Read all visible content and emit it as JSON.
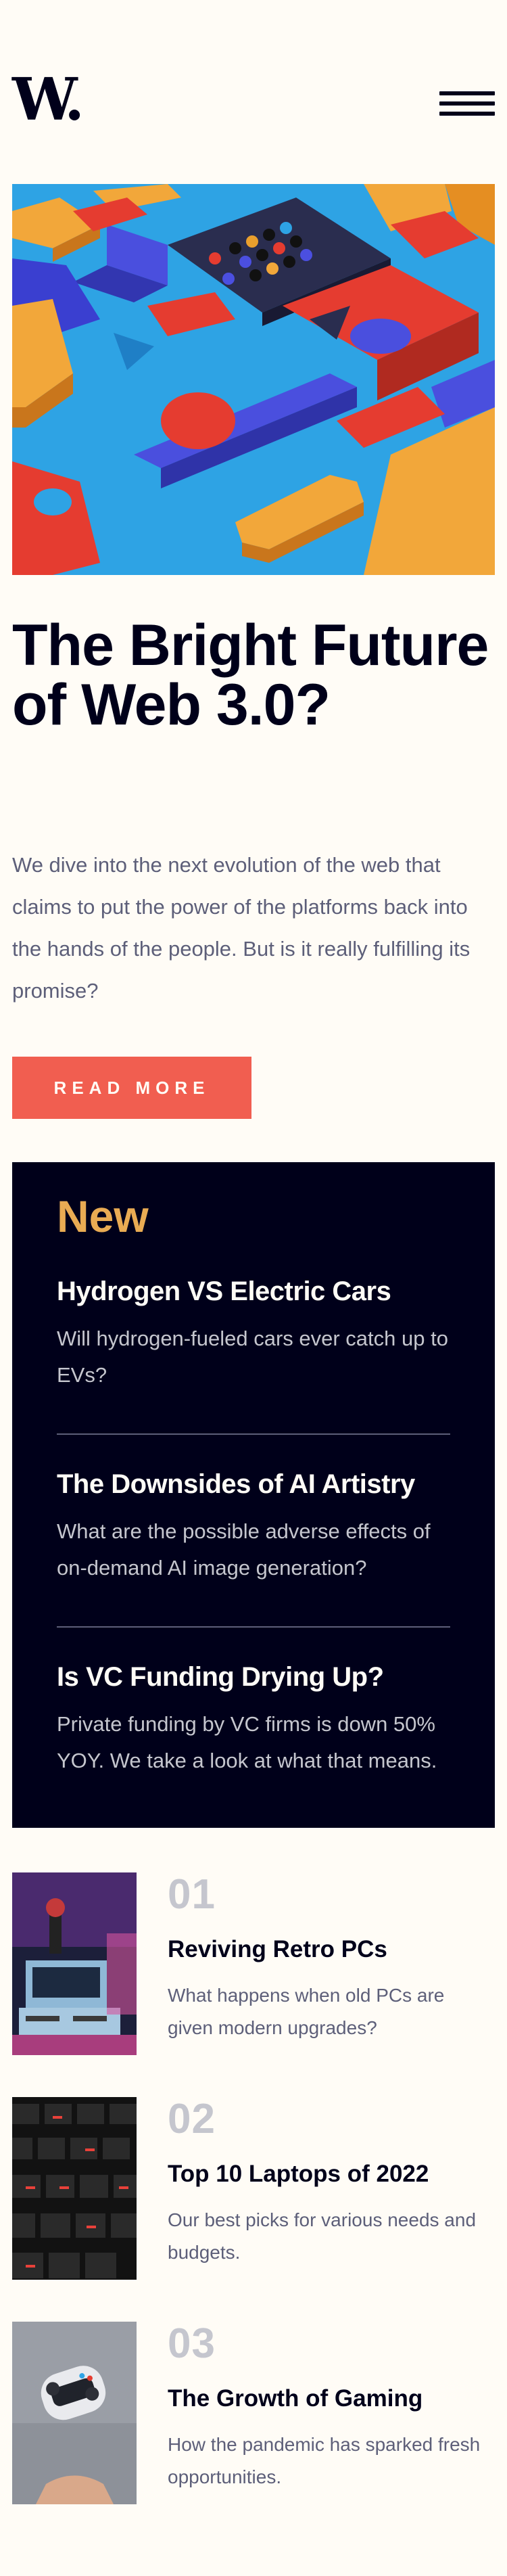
{
  "header": {
    "logo_text": "W.",
    "menu_icon": "hamburger-menu-icon"
  },
  "hero": {
    "image_icon": "abstract-3d-blocks-image",
    "headline": "The Bright Future of Web 3.0?",
    "intro": "We dive into the next evolution of the web that claims to put the power of the platforms back into the hands of the people. But is it really fulfilling its promise?",
    "cta_label": "READ MORE"
  },
  "new_panel": {
    "title": "New",
    "items": [
      {
        "title": "Hydrogen VS Electric Cars",
        "description": "Will hydrogen-fueled cars ever catch up to EVs?"
      },
      {
        "title": "The Downsides of AI Artistry",
        "description": "What are the possible adverse effects of on-demand AI image generation?"
      },
      {
        "title": "Is VC Funding Drying Up?",
        "description": "Private funding by VC firms is down 50% YOY. We take a look at what that means."
      }
    ]
  },
  "articles": [
    {
      "number": "01",
      "title": "Reviving Retro PCs",
      "description": "What happens when old PCs are given modern upgrades?",
      "image_icon": "retro-pc-image"
    },
    {
      "number": "02",
      "title": "Top 10 Laptops of 2022",
      "description": "Our best picks for various needs and budgets.",
      "image_icon": "laptop-keyboard-image"
    },
    {
      "number": "03",
      "title": "The Growth of Gaming",
      "description": "How the pandemic has sparked fresh opportunities.",
      "image_icon": "game-controller-image"
    }
  ],
  "colors": {
    "background": "#fffcf6",
    "dark": "#00001a",
    "accent_red": "#f15e50",
    "accent_orange": "#e9ab53",
    "muted_text": "#5d5f79",
    "light_grey": "#c5c6ce"
  }
}
